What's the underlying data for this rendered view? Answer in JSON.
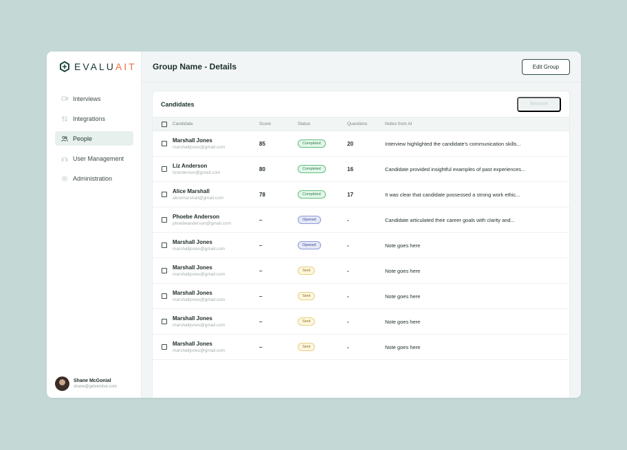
{
  "brand": {
    "prefix": "EVALU",
    "accent": "AIT",
    "accent_color": "#e8713f"
  },
  "sidebar": {
    "items": [
      {
        "label": "Interviews",
        "icon": "interviews-icon",
        "active": false
      },
      {
        "label": "Integrations",
        "icon": "integrations-icon",
        "active": false
      },
      {
        "label": "People",
        "icon": "people-icon",
        "active": true
      },
      {
        "label": "User Management",
        "icon": "user-management-icon",
        "active": false
      },
      {
        "label": "Administration",
        "icon": "settings-icon",
        "active": false
      }
    ],
    "user": {
      "name": "Shane McGonial",
      "email": "shane@getventive.com"
    }
  },
  "header": {
    "title": "Group Name - Details",
    "edit_label": "Edit Group"
  },
  "card": {
    "title": "Candidates",
    "remove_label": "Remove"
  },
  "table": {
    "columns": [
      "Candidate",
      "Score",
      "Status",
      "Questions",
      "Notes from AI"
    ],
    "rows": [
      {
        "name": "Marshall Jones",
        "email": "marshalljones@gmail.com",
        "score": "85",
        "status": "Completed",
        "status_kind": "completed",
        "questions": "20",
        "notes": "Interview highlighted the candidate's communication skills..."
      },
      {
        "name": "Liz Anderson",
        "email": "lizanderson@gmail.com",
        "score": "80",
        "status": "Completed",
        "status_kind": "completed",
        "questions": "16",
        "notes": "Candidate provided insightful examples of past experiences..."
      },
      {
        "name": "Alice Marshall",
        "email": "alicemarshall@gmail.com",
        "score": "78",
        "status": "Completed",
        "status_kind": "completed",
        "questions": "17",
        "notes": "It was clear that candidate possessed a strong work ethic..."
      },
      {
        "name": "Phoebe Anderson",
        "email": "phoebeanderson@gmail.com",
        "score": "–",
        "status": "Opened",
        "status_kind": "opened",
        "questions": "-",
        "notes": "Candidate articulated their career goals with clarity and..."
      },
      {
        "name": "Marshall Jones",
        "email": "marshalljones@gmail.com",
        "score": "–",
        "status": "Opened",
        "status_kind": "opened",
        "questions": "-",
        "notes": "Note goes here"
      },
      {
        "name": "Marshall Jones",
        "email": "marshalljones@gmail.com",
        "score": "–",
        "status": "Sent",
        "status_kind": "sent",
        "questions": "-",
        "notes": "Note goes here"
      },
      {
        "name": "Marshall Jones",
        "email": "marshalljones@gmail.com",
        "score": "–",
        "status": "Sent",
        "status_kind": "sent",
        "questions": "-",
        "notes": "Note goes here"
      },
      {
        "name": "Marshall Jones",
        "email": "marshalljones@gmail.com",
        "score": "–",
        "status": "Sent",
        "status_kind": "sent",
        "questions": "-",
        "notes": "Note goes here"
      },
      {
        "name": "Marshall Jones",
        "email": "marshalljones@gmail.com",
        "score": "–",
        "status": "Sent",
        "status_kind": "sent",
        "questions": "-",
        "notes": "Note goes here"
      }
    ]
  }
}
